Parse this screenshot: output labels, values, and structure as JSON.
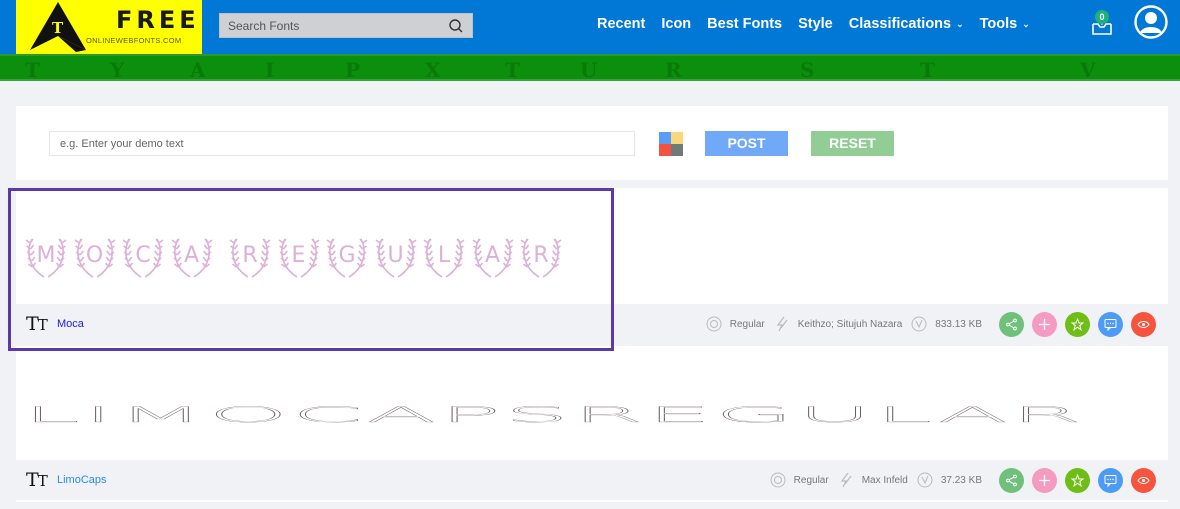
{
  "header": {
    "logo": {
      "title": "FREE",
      "subtitle": "ONLINEWEBFONTS.COM",
      "letter": "T"
    },
    "search": {
      "placeholder": "Search Fonts",
      "value": ""
    },
    "nav": [
      {
        "label": "Recent",
        "dropdown": false
      },
      {
        "label": "Icon",
        "dropdown": false
      },
      {
        "label": "Best Fonts",
        "dropdown": false
      },
      {
        "label": "Style",
        "dropdown": false
      },
      {
        "label": "Classifications",
        "dropdown": true
      },
      {
        "label": "Tools",
        "dropdown": true
      }
    ],
    "inbox_count": "0",
    "colors": {
      "topbar": "#0278d6",
      "logo_bg": "#ffff00",
      "banner": "#0c8f0c"
    }
  },
  "banner": {
    "decor_letters": [
      "T",
      "Y",
      "A",
      "I",
      "P",
      "X",
      "T",
      "U",
      "R",
      "S",
      "T",
      "V"
    ]
  },
  "toolbar": {
    "demo_placeholder": "e.g. Enter your demo text",
    "demo_value": "",
    "color_picker_colors": [
      "#5b9cf5",
      "#f9d77b",
      "#f3523f",
      "#6f7b77"
    ],
    "post_label": "POST",
    "reset_label": "RESET"
  },
  "fonts": [
    {
      "name": "Moca",
      "preview_text": "MOCA REGULAR",
      "style": "Regular",
      "designer": "Keithzo; Situjuh Nazara",
      "size": "833.13 KB",
      "preview_color": "#ddb1d6",
      "highlighted": true
    },
    {
      "name": "LimoCaps",
      "preview_text": "LIMOCAPSREGULAR",
      "style": "Regular",
      "designer": "Max Infeld",
      "size": "37.23 KB",
      "preview_color": "#6b5b5b",
      "highlighted": false
    }
  ],
  "actions": [
    {
      "name": "share",
      "color": "#6fc07b"
    },
    {
      "name": "add",
      "color": "#f59ac0"
    },
    {
      "name": "favorite",
      "color": "#6fbd17"
    },
    {
      "name": "comment",
      "color": "#4d9bf5"
    },
    {
      "name": "view",
      "color": "#f5543e"
    }
  ]
}
